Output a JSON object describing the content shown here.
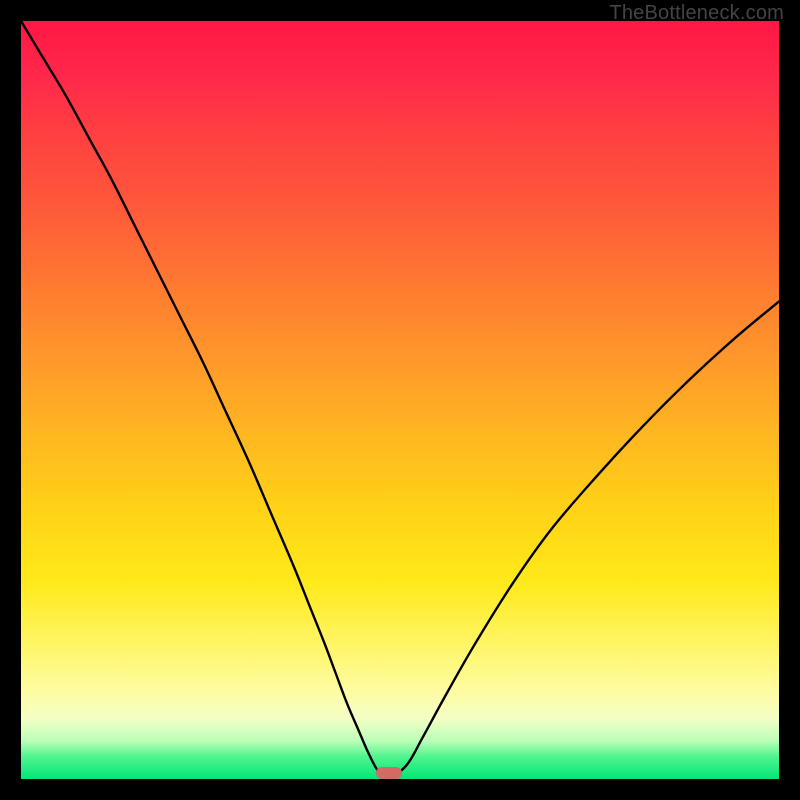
{
  "watermark": {
    "text": "TheBottleneck.com"
  },
  "chart_data": {
    "type": "line",
    "title": "",
    "xlabel": "",
    "ylabel": "",
    "xlim": [
      0,
      100
    ],
    "ylim": [
      0,
      100
    ],
    "grid": false,
    "legend": false,
    "background": {
      "kind": "vertical-gradient",
      "stops": [
        {
          "pos": 0.0,
          "color": "#ff1744"
        },
        {
          "pos": 0.5,
          "color": "#ffc107"
        },
        {
          "pos": 0.85,
          "color": "#fff176"
        },
        {
          "pos": 1.0,
          "color": "#00e676"
        }
      ]
    },
    "series": [
      {
        "name": "bottleneck-curve",
        "color": "#000000",
        "x": [
          0,
          3,
          6,
          9,
          12,
          15,
          18,
          21,
          24,
          27,
          30,
          33,
          36,
          38,
          40,
          41.5,
          43,
          44.5,
          45.8,
          47,
          48,
          49,
          51,
          53,
          56,
          60,
          65,
          70,
          76,
          82,
          88,
          94,
          100
        ],
        "y": [
          100,
          95,
          90,
          84.5,
          79,
          73,
          67,
          61,
          55,
          48.5,
          42,
          35,
          28,
          23,
          18,
          14,
          10,
          6.5,
          3.5,
          1.2,
          0.3,
          0.3,
          2,
          5.5,
          11,
          18,
          26,
          33,
          40,
          46.5,
          52.5,
          58,
          63
        ]
      }
    ],
    "markers": [
      {
        "name": "optimal-point",
        "shape": "pill",
        "color": "#d36a64",
        "x": 48.5,
        "y": 0.8
      }
    ]
  }
}
